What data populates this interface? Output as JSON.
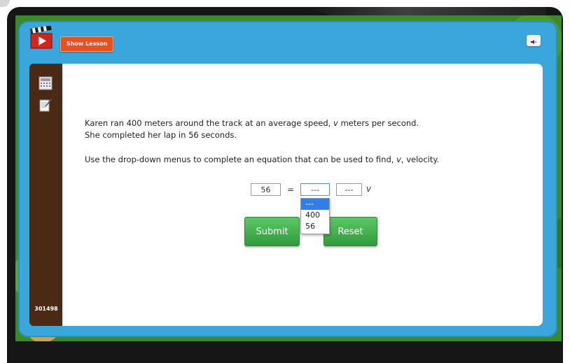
{
  "toolbar": {
    "show_lesson_label": "Show Lesson"
  },
  "sidebar": {
    "question_id": "301498",
    "icons": [
      "calculator-icon",
      "notepad-icon"
    ]
  },
  "problem": {
    "line1_a": "Karen ran 400 meters around the track at an average speed, ",
    "line1_var": "v",
    "line1_b": " meters per second.",
    "line2": "She completed her lap in 56 seconds.",
    "instruction_a": "Use the drop-down menus to complete an equation that can be used to find, ",
    "instruction_var": "v",
    "instruction_b": ", velocity."
  },
  "equation": {
    "lhs_value": "56",
    "equals": "=",
    "dropdown1_value": "---",
    "dropdown2_value": "---",
    "variable": "v"
  },
  "dropdown_options": [
    "---",
    "400",
    "56"
  ],
  "buttons": {
    "submit_label": "Submit",
    "reset_label": "Reset"
  },
  "colors": {
    "window_blue": "#3aa7dc",
    "sidebar_brown": "#4a2a14",
    "show_lesson_orange": "#e8501e",
    "button_green": "#3fae48",
    "dropdown_highlight": "#2f7fe6"
  }
}
